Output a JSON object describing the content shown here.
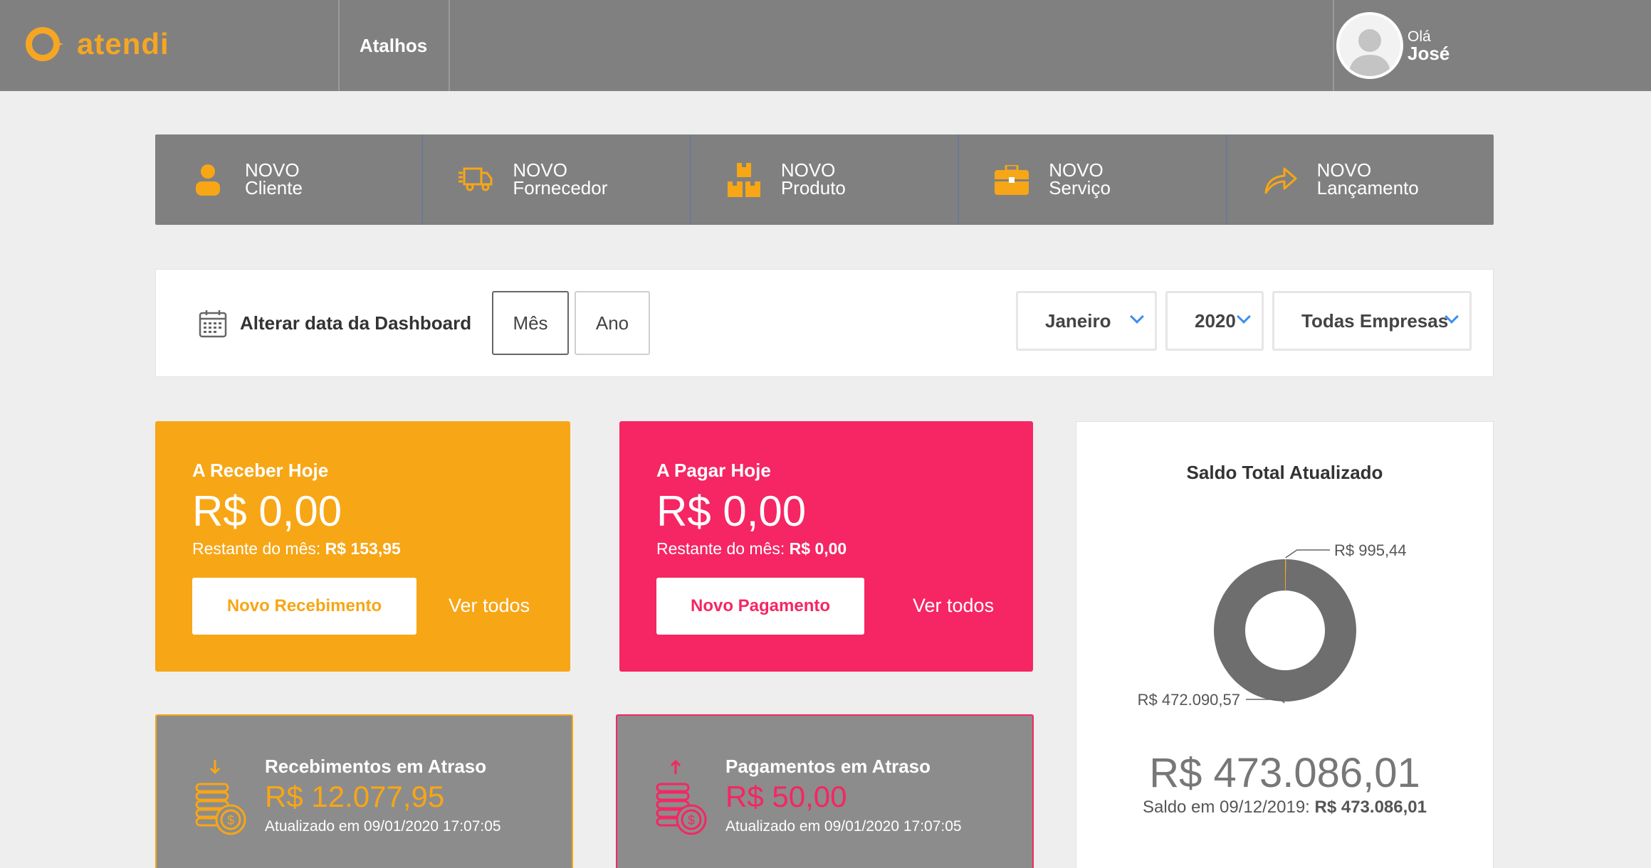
{
  "header": {
    "logo_text": "atendi",
    "nav_atalhos": "Atalhos",
    "greeting": "Olá",
    "user_name": "José"
  },
  "shortcuts": [
    {
      "line1": "NOVO",
      "line2": "Cliente",
      "icon": "user-icon"
    },
    {
      "line1": "NOVO",
      "line2": "Fornecedor",
      "icon": "truck-icon"
    },
    {
      "line1": "NOVO",
      "line2": "Produto",
      "icon": "boxes-icon"
    },
    {
      "line1": "NOVO",
      "line2": "Serviço",
      "icon": "briefcase-icon"
    },
    {
      "line1": "NOVO",
      "line2": "Lançamento",
      "icon": "share-arrow-icon"
    }
  ],
  "filter": {
    "label": "Alterar data da Dashboard",
    "mes": "Mês",
    "ano": "Ano",
    "month_select": "Janeiro",
    "year_select": "2020",
    "company_select": "Todas Empresas"
  },
  "receber": {
    "title": "A Receber Hoje",
    "amount": "R$ 0,00",
    "rest_label": "Restante do mês:",
    "rest_value": "R$ 153,95",
    "button": "Novo Recebimento",
    "link": "Ver todos"
  },
  "pagar": {
    "title": "A Pagar Hoje",
    "amount": "R$ 0,00",
    "rest_label": "Restante do mês:",
    "rest_value": "R$ 0,00",
    "button": "Novo Pagamento",
    "link": "Ver todos"
  },
  "saldo": {
    "title": "Saldo Total Atualizado",
    "total": "R$ 473.086,01",
    "date_label": "Saldo em 09/12/2019:",
    "date_value": "R$ 473.086,01"
  },
  "chart_data": {
    "type": "pie",
    "title": "Saldo Total Atualizado",
    "labels": [
      "R$ 995,44",
      "R$ 472.090,57"
    ],
    "values": [
      995.44,
      472090.57
    ],
    "colors": [
      "#f7a616",
      "#6e6e6e"
    ]
  },
  "atraso_rec": {
    "title": "Recebimentos em Atraso",
    "amount": "R$ 12.077,95",
    "updated": "Atualizado em 09/01/2020 17:07:05"
  },
  "atraso_pag": {
    "title": "Pagamentos em Atraso",
    "amount": "R$ 50,00",
    "updated": "Atualizado em 09/01/2020 17:07:05"
  },
  "colors": {
    "brand": "#f5a623",
    "receber": "#f7a616",
    "pagar": "#f52663",
    "header_bg": "#808080",
    "accent_blue": "#3d8ef0"
  }
}
